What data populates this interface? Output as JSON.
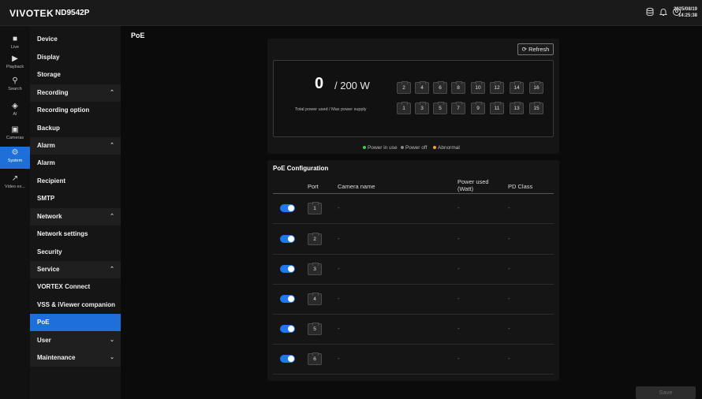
{
  "header": {
    "logo": "VIVOTEK",
    "model": "ND9542P",
    "date": "2025/08/19",
    "time": "14:25:38",
    "icons": [
      "database-icon",
      "bell-icon",
      "user-icon"
    ]
  },
  "rail": [
    {
      "label": "Live",
      "icon": "live-icon"
    },
    {
      "label": "Playback",
      "icon": "playback-icon"
    },
    {
      "label": "Search",
      "icon": "search-icon"
    },
    {
      "label": "AI",
      "icon": "ai-icon"
    },
    {
      "label": "Cameras",
      "icon": "cameras-icon"
    },
    {
      "label": "System",
      "icon": "gear-icon",
      "active": true
    },
    {
      "label": "Video ex...",
      "icon": "export-icon"
    }
  ],
  "menu": [
    {
      "label": "Device"
    },
    {
      "label": "Display"
    },
    {
      "label": "Storage"
    },
    {
      "label": "Recording",
      "group": true,
      "chevron": "up"
    },
    {
      "label": "Recording option"
    },
    {
      "label": "Backup"
    },
    {
      "label": "Alarm",
      "group": true,
      "chevron": "up"
    },
    {
      "label": "Alarm"
    },
    {
      "label": "Recipient"
    },
    {
      "label": "SMTP"
    },
    {
      "label": "Network",
      "group": true,
      "chevron": "up"
    },
    {
      "label": "Network settings"
    },
    {
      "label": "Security"
    },
    {
      "label": "Service",
      "group": true,
      "chevron": "up"
    },
    {
      "label": "VORTEX Connect"
    },
    {
      "label": "VSS & iViewer companion"
    },
    {
      "label": "PoE",
      "active": true
    },
    {
      "label": "User",
      "group": true,
      "chevron": "down"
    },
    {
      "label": "Maintenance",
      "group": true,
      "chevron": "down"
    }
  ],
  "page": {
    "title": "PoE",
    "refresh_label": "Refresh",
    "power_used": "0",
    "power_max": "/ 200 W",
    "power_caption": "Total power used / Max power supply",
    "ports_top": [
      "2",
      "4",
      "6",
      "8",
      "10",
      "12",
      "14",
      "16"
    ],
    "ports_bottom": [
      "1",
      "3",
      "5",
      "7",
      "9",
      "11",
      "13",
      "15"
    ],
    "legend": {
      "in_use": "Power in use",
      "off": "Power off",
      "abnormal": "Abnormal"
    },
    "colors": {
      "in_use": "#3ccf4e",
      "off": "#888888",
      "abnormal": "#f5a623",
      "accent": "#1e6fd9"
    }
  },
  "config": {
    "title": "PoE Configuration",
    "headers": {
      "port": "Port",
      "camera": "Camera name",
      "power": "Power used (Watt)",
      "pd_class": "PD Class"
    },
    "rows": [
      {
        "port": "1",
        "camera": "-",
        "power": "-",
        "pd_class": "-",
        "enabled": true
      },
      {
        "port": "2",
        "camera": "-",
        "power": "-",
        "pd_class": "-",
        "enabled": true
      },
      {
        "port": "3",
        "camera": "-",
        "power": "-",
        "pd_class": "-",
        "enabled": true
      },
      {
        "port": "4",
        "camera": "-",
        "power": "-",
        "pd_class": "-",
        "enabled": true
      },
      {
        "port": "5",
        "camera": "-",
        "power": "-",
        "pd_class": "-",
        "enabled": true
      },
      {
        "port": "6",
        "camera": "-",
        "power": "-",
        "pd_class": "-",
        "enabled": true
      }
    ]
  },
  "footer": {
    "save_label": "Save"
  }
}
